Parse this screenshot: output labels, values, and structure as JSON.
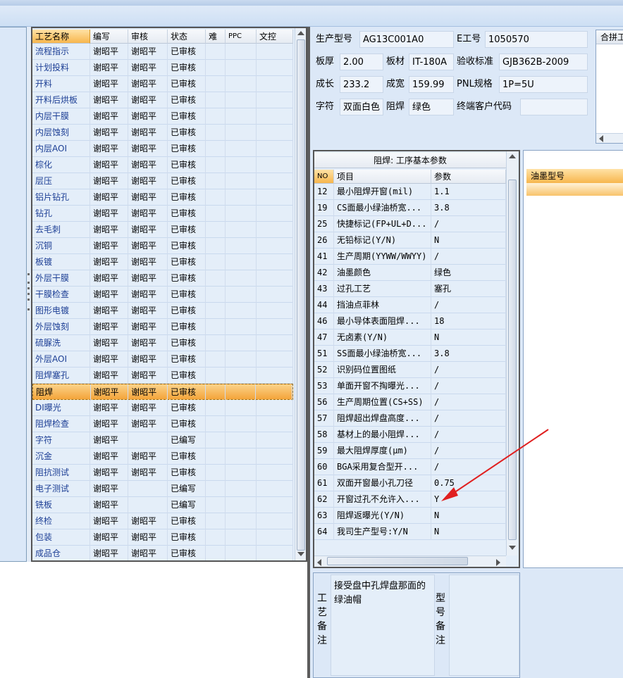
{
  "process_table": {
    "columns": [
      "工艺名称",
      "编写",
      "审核",
      "状态",
      "难",
      "PPC",
      "文控"
    ],
    "selected_index": 21,
    "rows": [
      {
        "name": "流程指示",
        "author": "谢昭平",
        "reviewer": "谢昭平",
        "status": "已审核"
      },
      {
        "name": "计划投料",
        "author": "谢昭平",
        "reviewer": "谢昭平",
        "status": "已审核"
      },
      {
        "name": "开料",
        "author": "谢昭平",
        "reviewer": "谢昭平",
        "status": "已审核"
      },
      {
        "name": "开料后烘板",
        "author": "谢昭平",
        "reviewer": "谢昭平",
        "status": "已审核"
      },
      {
        "name": "内层干膜",
        "author": "谢昭平",
        "reviewer": "谢昭平",
        "status": "已审核"
      },
      {
        "name": "内层蚀刻",
        "author": "谢昭平",
        "reviewer": "谢昭平",
        "status": "已审核"
      },
      {
        "name": "内层AOI",
        "author": "谢昭平",
        "reviewer": "谢昭平",
        "status": "已审核"
      },
      {
        "name": "棕化",
        "author": "谢昭平",
        "reviewer": "谢昭平",
        "status": "已审核"
      },
      {
        "name": "层压",
        "author": "谢昭平",
        "reviewer": "谢昭平",
        "status": "已审核"
      },
      {
        "name": "铝片钻孔",
        "author": "谢昭平",
        "reviewer": "谢昭平",
        "status": "已审核"
      },
      {
        "name": "钻孔",
        "author": "谢昭平",
        "reviewer": "谢昭平",
        "status": "已审核"
      },
      {
        "name": "去毛刺",
        "author": "谢昭平",
        "reviewer": "谢昭平",
        "status": "已审核"
      },
      {
        "name": "沉铜",
        "author": "谢昭平",
        "reviewer": "谢昭平",
        "status": "已审核"
      },
      {
        "name": "板镀",
        "author": "谢昭平",
        "reviewer": "谢昭平",
        "status": "已审核"
      },
      {
        "name": "外层干膜",
        "author": "谢昭平",
        "reviewer": "谢昭平",
        "status": "已审核"
      },
      {
        "name": "干膜检查",
        "author": "谢昭平",
        "reviewer": "谢昭平",
        "status": "已审核"
      },
      {
        "name": "图形电镀",
        "author": "谢昭平",
        "reviewer": "谢昭平",
        "status": "已审核"
      },
      {
        "name": "外层蚀刻",
        "author": "谢昭平",
        "reviewer": "谢昭平",
        "status": "已审核"
      },
      {
        "name": "硫脲洗",
        "author": "谢昭平",
        "reviewer": "谢昭平",
        "status": "已审核"
      },
      {
        "name": "外层AOI",
        "author": "谢昭平",
        "reviewer": "谢昭平",
        "status": "已审核"
      },
      {
        "name": "阻焊塞孔",
        "author": "谢昭平",
        "reviewer": "谢昭平",
        "status": "已审核"
      },
      {
        "name": "阻焊",
        "author": "谢昭平",
        "reviewer": "谢昭平",
        "status": "已审核"
      },
      {
        "name": "DI曝光",
        "author": "谢昭平",
        "reviewer": "谢昭平",
        "status": "已审核"
      },
      {
        "name": "阻焊检查",
        "author": "谢昭平",
        "reviewer": "谢昭平",
        "status": "已审核"
      },
      {
        "name": "字符",
        "author": "谢昭平",
        "reviewer": "",
        "status": "已编写"
      },
      {
        "name": "沉金",
        "author": "谢昭平",
        "reviewer": "谢昭平",
        "status": "已审核"
      },
      {
        "name": "阻抗测试",
        "author": "谢昭平",
        "reviewer": "谢昭平",
        "status": "已审核"
      },
      {
        "name": "电子测试",
        "author": "谢昭平",
        "reviewer": "",
        "status": "已编写"
      },
      {
        "name": "铣板",
        "author": "谢昭平",
        "reviewer": "",
        "status": "已编写"
      },
      {
        "name": "终检",
        "author": "谢昭平",
        "reviewer": "谢昭平",
        "status": "已审核"
      },
      {
        "name": "包装",
        "author": "谢昭平",
        "reviewer": "谢昭平",
        "status": "已审核"
      },
      {
        "name": "成品仓",
        "author": "谢昭平",
        "reviewer": "谢昭平",
        "status": "已审核"
      }
    ]
  },
  "info": {
    "model_label": "生产型号",
    "model_value": "AG13C001A0",
    "eno_label": "E工号",
    "eno_value": "1050570",
    "thickness_label": "板厚",
    "thickness_value": "2.00",
    "material_label": "板材",
    "material_value": "IT-180A",
    "standard_label": "验收标准",
    "standard_value": "GJB362B-2009",
    "length_label": "成长",
    "length_value": "233.2",
    "width_label": "成宽",
    "width_value": "159.99",
    "pnl_label": "PNL规格",
    "pnl_value": "1P=5U",
    "char_label": "字符",
    "char_value": "双面白色",
    "mask_label": "阻焊",
    "mask_value": "绿色",
    "customer_label": "终端客户代码",
    "customer_value": ""
  },
  "merge_panel": {
    "header": "合拼工"
  },
  "params": {
    "title": "阻焊: 工序基本参数",
    "col_no": "NO",
    "col_item": "项目",
    "col_value": "参数",
    "rows": [
      {
        "no": "12",
        "item": "最小阻焊开窗(mil)",
        "value": "1.1"
      },
      {
        "no": "19",
        "item": "CS面最小绿油桥宽...",
        "value": "3.8"
      },
      {
        "no": "25",
        "item": "快捷标记(FP+UL+D...",
        "value": "/"
      },
      {
        "no": "26",
        "item": "无铅标记(Y/N)",
        "value": "N"
      },
      {
        "no": "41",
        "item": "生产周期(YYWW/WWYY)",
        "value": "/"
      },
      {
        "no": "42",
        "item": "油墨颜色",
        "value": "绿色"
      },
      {
        "no": "43",
        "item": "过孔工艺",
        "value": "塞孔"
      },
      {
        "no": "44",
        "item": "挡油点菲林",
        "value": "/"
      },
      {
        "no": "46",
        "item": "最小导体表面阻焊...",
        "value": "18"
      },
      {
        "no": "47",
        "item": "无卤素(Y/N)",
        "value": "N"
      },
      {
        "no": "51",
        "item": "SS面最小绿油桥宽...",
        "value": "3.8"
      },
      {
        "no": "52",
        "item": "识别码位置图纸",
        "value": "/"
      },
      {
        "no": "53",
        "item": "单面开窗不掏曝光...",
        "value": "/"
      },
      {
        "no": "56",
        "item": "生产周期位置(CS+SS)",
        "value": "/"
      },
      {
        "no": "57",
        "item": "阻焊超出焊盘高度...",
        "value": "/"
      },
      {
        "no": "58",
        "item": "基材上的最小阻焊...",
        "value": "/"
      },
      {
        "no": "59",
        "item": "最大阻焊厚度(μm)",
        "value": "/"
      },
      {
        "no": "60",
        "item": "BGA采用复合型开...",
        "value": "/"
      },
      {
        "no": "61",
        "item": "双面开窗最小孔刀径",
        "value": "0.75"
      },
      {
        "no": "62",
        "item": "开窗过孔不允许入...",
        "value": "Y"
      },
      {
        "no": "63",
        "item": "阻焊返曝光(Y/N)",
        "value": "N"
      },
      {
        "no": "64",
        "item": "我司生产型号:Y/N",
        "value": "N"
      }
    ]
  },
  "ink_panel": {
    "header": "油墨型号"
  },
  "remarks": {
    "process_label": "工艺备注",
    "process_text": "接受盘中孔焊盘那面的绿油帽",
    "model_label": "型号备注",
    "model_text": ""
  },
  "colors": {
    "selection": "#f4a43a",
    "link_text": "#1d3f95",
    "annotation_arrow": "#e02020"
  }
}
